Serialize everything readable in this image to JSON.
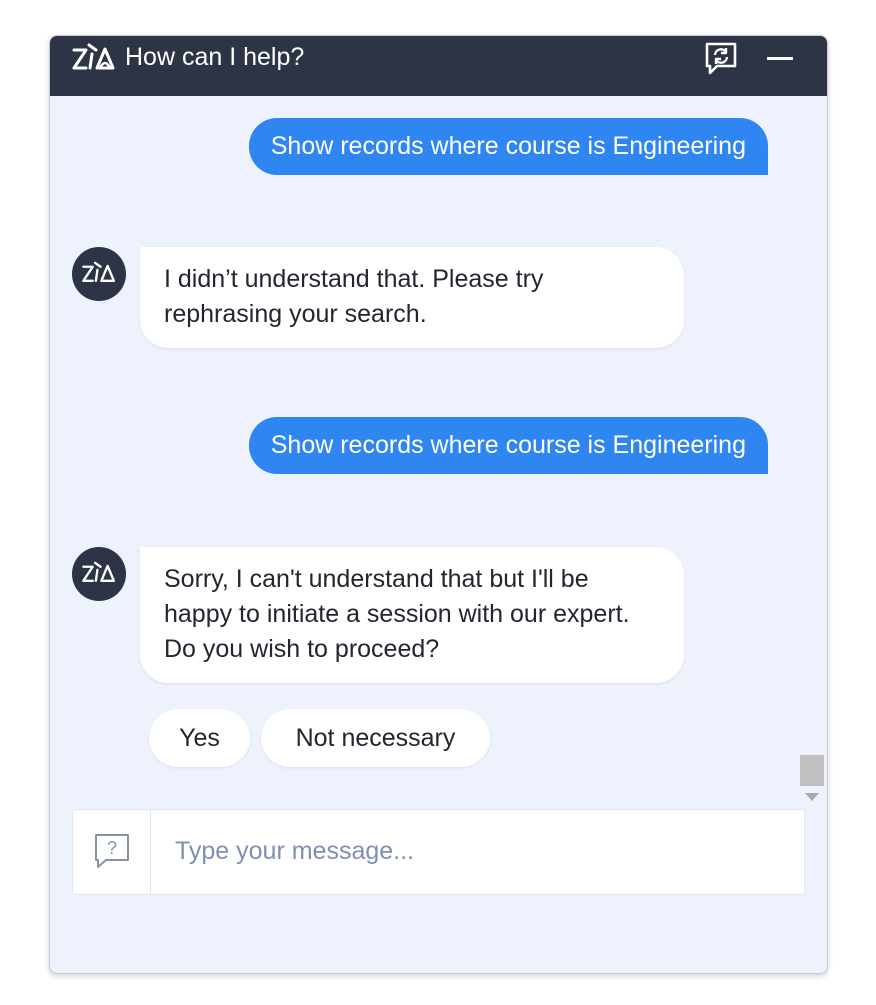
{
  "header": {
    "title": "How can I help?",
    "logo_text": "Zia",
    "swap_icon": "chat-swap-icon",
    "minimize_icon": "minimize-icon",
    "bg_color": "#2d3446"
  },
  "messages": [
    {
      "sender": "user",
      "text": "Show records where course is Engineering"
    },
    {
      "sender": "bot",
      "text": "I didn’t understand that. Please try rephrasing your search."
    },
    {
      "sender": "user",
      "text": "Show records where course is Engineering"
    },
    {
      "sender": "bot",
      "text": "Sorry, I can't understand that but I'll be happy to initiate a session with our expert. Do you wish to proceed?"
    }
  ],
  "quick_replies": [
    {
      "label": "Yes"
    },
    {
      "label": "Not necessary"
    }
  ],
  "input": {
    "placeholder": "Type your message...",
    "value": "",
    "help_icon": "question-bubble-icon"
  },
  "colors": {
    "user_bubble": "#2f86f0",
    "background": "#eef2fc"
  }
}
